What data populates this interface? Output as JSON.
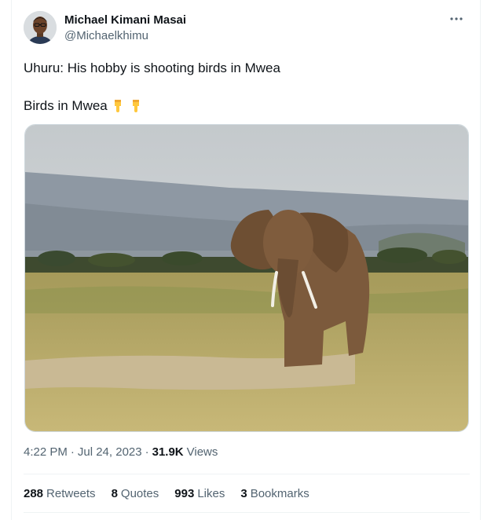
{
  "author": {
    "display_name": "Michael Kimani Masai",
    "handle": "@Michaelkhimu"
  },
  "tweet": {
    "line1": "Uhuru: His hobby is shooting birds in Mwea",
    "line2": "Birds in Mwea",
    "line2_emoji": [
      "pointing-down-emoji",
      "pointing-down-emoji"
    ]
  },
  "meta": {
    "time": "4:22 PM",
    "date": "Jul 24, 2023",
    "views_count": "31.9K",
    "views_label": "Views",
    "separator": "·"
  },
  "stats": [
    {
      "count": "288",
      "label": "Retweets"
    },
    {
      "count": "8",
      "label": "Quotes"
    },
    {
      "count": "993",
      "label": "Likes"
    },
    {
      "count": "3",
      "label": "Bookmarks"
    }
  ],
  "icons": {
    "more": "more-dots-icon"
  },
  "colors": {
    "text": "#0f1419",
    "secondary": "#536471",
    "border": "#eff3f4",
    "emoji": "#ffc83d"
  }
}
